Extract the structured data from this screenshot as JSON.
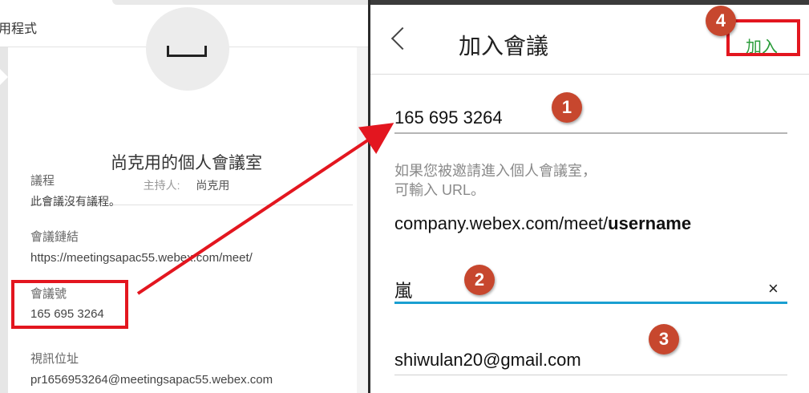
{
  "left": {
    "app_title": "用程式",
    "room_title": "尚克用的個人會議室",
    "host_label": "主持人:",
    "host_name": "尚克用",
    "agenda_label": "議程",
    "agenda_value": "此會議沒有議程。",
    "link_label": "會議鏈結",
    "link_value": "https://meetingsapac55.webex.com/meet/",
    "number_label": "會議號",
    "number_value": "165 695 3264",
    "video_label": "視訊位址",
    "video_value": "pr1656953264@meetingsapac55.webex.com"
  },
  "right": {
    "back_icon": "chevron-left-icon",
    "title": "加入會議",
    "join_label": "加入",
    "meeting_number": "165 695 3264",
    "hint_line1": "如果您被邀請進入個人會議室，",
    "hint_line2": "可輸入 URL。",
    "url_prefix": "company.webex.com/meet/",
    "url_bold": "username",
    "name_value": "嵐",
    "clear_icon": "×",
    "email_value": "shiwulan20@gmail.com",
    "accent_color": "#1a9fd1",
    "join_color": "#2a9c3a"
  },
  "annotations": {
    "badge1": "1",
    "badge2": "2",
    "badge3": "3",
    "badge4": "4",
    "highlight_color": "#e3161f",
    "badge_color": "#c7472e"
  }
}
